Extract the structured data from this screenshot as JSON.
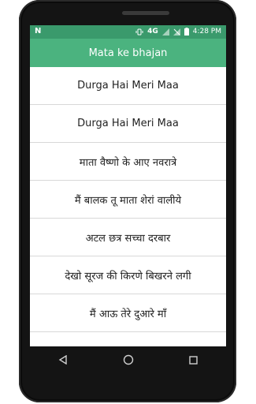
{
  "status_bar": {
    "notification_icon": "N",
    "network": "4G",
    "time": "4:28 PM"
  },
  "app_bar": {
    "title": "Mata ke bhajan"
  },
  "list": {
    "items": [
      {
        "label": "Durga Hai Meri Maa"
      },
      {
        "label": "Durga Hai Meri Maa"
      },
      {
        "label": "माता वैष्णो के आए नवरात्रे"
      },
      {
        "label": "मैं बालक तू माता शेरां वालीये"
      },
      {
        "label": "अटल छत्र सच्चा दरबार"
      },
      {
        "label": "देखो सूरज की किरणे बिखरने लगी"
      },
      {
        "label": "मैं आऊ तेरे दुआरे माँ"
      }
    ]
  },
  "colors": {
    "appbar": "#4bb37f",
    "statusbar": "#3a9a6c"
  },
  "navbar": {
    "back": "back-icon",
    "home": "home-icon",
    "recents": "recents-icon"
  }
}
